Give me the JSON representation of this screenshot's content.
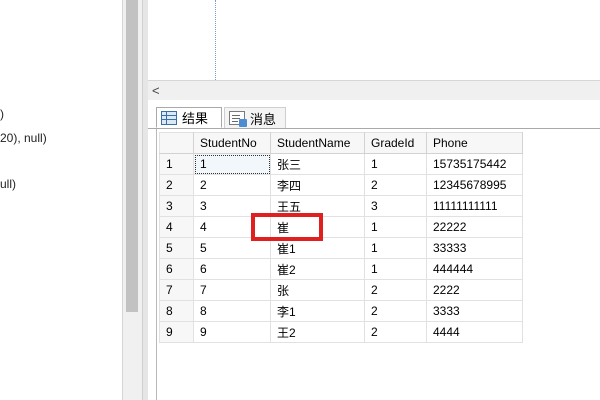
{
  "left_panel": {
    "code_lines": [
      ")",
      "20), null)",
      "ull)"
    ]
  },
  "scrollbar": {
    "left_arrow": "<"
  },
  "tabs": [
    {
      "label": "结果",
      "icon": "grid-icon",
      "active": true
    },
    {
      "label": "消息",
      "icon": "message-icon",
      "active": false
    }
  ],
  "grid": {
    "columns": [
      "StudentNo",
      "StudentName",
      "GradeId",
      "Phone"
    ],
    "rows": [
      {
        "num": "1",
        "cells": [
          "1",
          "张三",
          "1",
          "15735175442"
        ]
      },
      {
        "num": "2",
        "cells": [
          "2",
          "李四",
          "2",
          "12345678995"
        ]
      },
      {
        "num": "3",
        "cells": [
          "3",
          "王五",
          "3",
          "11111111111"
        ]
      },
      {
        "num": "4",
        "cells": [
          "4",
          "崔",
          "1",
          "22222"
        ]
      },
      {
        "num": "5",
        "cells": [
          "5",
          "崔1",
          "1",
          "33333"
        ]
      },
      {
        "num": "6",
        "cells": [
          "6",
          "崔2",
          "1",
          "444444"
        ]
      },
      {
        "num": "7",
        "cells": [
          "7",
          "张",
          "2",
          "2222"
        ]
      },
      {
        "num": "8",
        "cells": [
          "8",
          "李1",
          "2",
          "3333"
        ]
      },
      {
        "num": "9",
        "cells": [
          "9",
          "王2",
          "2",
          "4444"
        ]
      }
    ],
    "selected_cell": {
      "row": 1,
      "column": "StudentNo"
    }
  },
  "colors": {
    "highlight_box": "#e0201f",
    "grid_header_bg": "#f7f7f7",
    "scrollbar_bg": "#f0f0f0"
  }
}
